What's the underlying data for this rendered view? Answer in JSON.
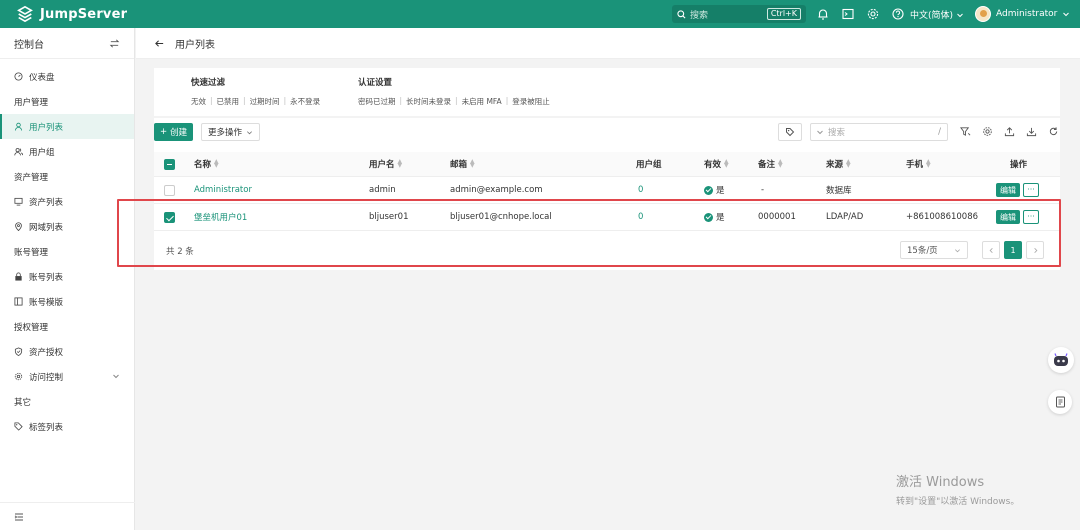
{
  "app": {
    "name": "JumpServer"
  },
  "topbar": {
    "search_placeholder": "搜索",
    "shortcut": "Ctrl+K",
    "language": "中文(简体)",
    "user": "Administrator"
  },
  "sidebar": {
    "title": "控制台",
    "sections": [
      {
        "type": "item",
        "label": "仪表盘",
        "icon": "dashboard-icon"
      },
      {
        "type": "group",
        "label": "用户管理"
      },
      {
        "type": "item",
        "label": "用户列表",
        "icon": "user-icon",
        "active": true
      },
      {
        "type": "item",
        "label": "用户组",
        "icon": "users-icon"
      },
      {
        "type": "group",
        "label": "资产管理"
      },
      {
        "type": "item",
        "label": "资产列表",
        "icon": "monitor-icon"
      },
      {
        "type": "item",
        "label": "网域列表",
        "icon": "location-icon"
      },
      {
        "type": "group",
        "label": "账号管理"
      },
      {
        "type": "item",
        "label": "账号列表",
        "icon": "lock-icon"
      },
      {
        "type": "item",
        "label": "账号模版",
        "icon": "template-icon"
      },
      {
        "type": "group",
        "label": "授权管理"
      },
      {
        "type": "item",
        "label": "资产授权",
        "icon": "shield-icon"
      },
      {
        "type": "item",
        "label": "访问控制",
        "icon": "gear-icon",
        "expandable": true
      },
      {
        "type": "group",
        "label": "其它"
      },
      {
        "type": "item",
        "label": "标签列表",
        "icon": "tag-icon"
      }
    ]
  },
  "page": {
    "title": "用户列表"
  },
  "quick_filters": {
    "groups": [
      {
        "title": "快速过滤",
        "links": [
          "无效",
          "已禁用",
          "过期时间",
          "永不登录"
        ]
      },
      {
        "title": "认证设置",
        "links": [
          "密码已过期",
          "长时间未登录",
          "未启用 MFA",
          "登录被阻止"
        ]
      }
    ]
  },
  "toolbar": {
    "create_label": "创建",
    "more_label": "更多操作",
    "search_placeholder": "搜索",
    "search_suffix": "/"
  },
  "table": {
    "columns": [
      "名称",
      "用户名",
      "邮箱",
      "用户组",
      "有效",
      "备注",
      "来源",
      "手机",
      "操作"
    ],
    "rows": [
      {
        "name": "Administrator",
        "username": "admin",
        "email": "admin@example.com",
        "groups": "0",
        "active": "是",
        "comment": "-",
        "source": "数据库",
        "phone": "",
        "checked": false
      },
      {
        "name": "堡垒机用户01",
        "username": "bljuser01",
        "email": "bljuser01@cnhope.local",
        "groups": "0",
        "active": "是",
        "comment": "0000001",
        "source": "LDAP/AD",
        "phone": "+861008610086",
        "checked": true
      }
    ],
    "edit_label": "编辑",
    "more_actions": "···"
  },
  "pagination": {
    "total": "共 2 条",
    "page_size": "15条/页",
    "current_page": "1"
  },
  "watermark": {
    "line1": "激活 Windows",
    "line2": "转到\"设置\"以激活 Windows。"
  },
  "colors": {
    "brand": "#1a9379",
    "highlight": "#e0464b"
  }
}
